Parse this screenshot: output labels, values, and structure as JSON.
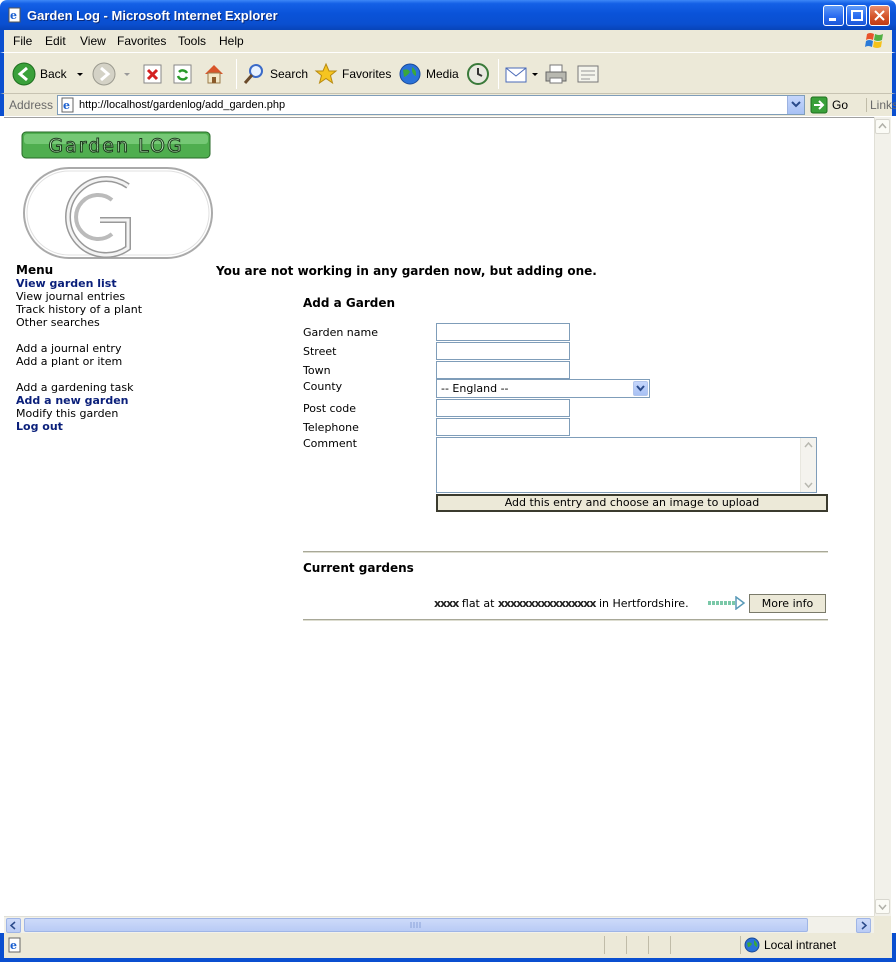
{
  "window": {
    "title": "Garden Log - Microsoft Internet Explorer"
  },
  "menubar": {
    "items": [
      "File",
      "Edit",
      "View",
      "Favorites",
      "Tools",
      "Help"
    ]
  },
  "toolbar": {
    "back": "Back",
    "search": "Search",
    "favorites": "Favorites",
    "media": "Media"
  },
  "addressbar": {
    "label": "Address",
    "url": "http://localhost/gardenlog/add_garden.php",
    "go": "Go",
    "links": "Links"
  },
  "status": {
    "zone": "Local intranet"
  },
  "logo": {
    "text": "Garden LOG",
    "letter": "G"
  },
  "menu": {
    "title": "Menu",
    "items": [
      "View garden list",
      "View journal entries",
      "Track history of a plant",
      "Other searches",
      "Add a journal entry",
      "Add a plant or item",
      "Add a gardening task",
      "Add a new garden",
      "Modify this garden",
      "Log out"
    ]
  },
  "page": {
    "notice": "You are not working in any garden now, but adding one.",
    "form_title": "Add a Garden",
    "labels": {
      "name": "Garden name",
      "street": "Street",
      "town": "Town",
      "county": "County",
      "postcode": "Post code",
      "telephone": "Telephone",
      "comment": "Comment"
    },
    "county_selected": "-- England --",
    "submit": "Add this entry and choose an image to upload",
    "current_title": "Current gardens",
    "garden_entry": {
      "redacted_1": "xxxx",
      "mid": " flat at ",
      "redacted_2": "xxxxxxxxxxxxxxxx",
      "tail": " in Hertfordshire."
    },
    "more_info": "More info"
  },
  "colors": {
    "titlebar": "#0a4fd0",
    "chrome": "#ece9d8",
    "link_bold": "#0a1f7a",
    "logo_green": "#3a9a3a"
  }
}
